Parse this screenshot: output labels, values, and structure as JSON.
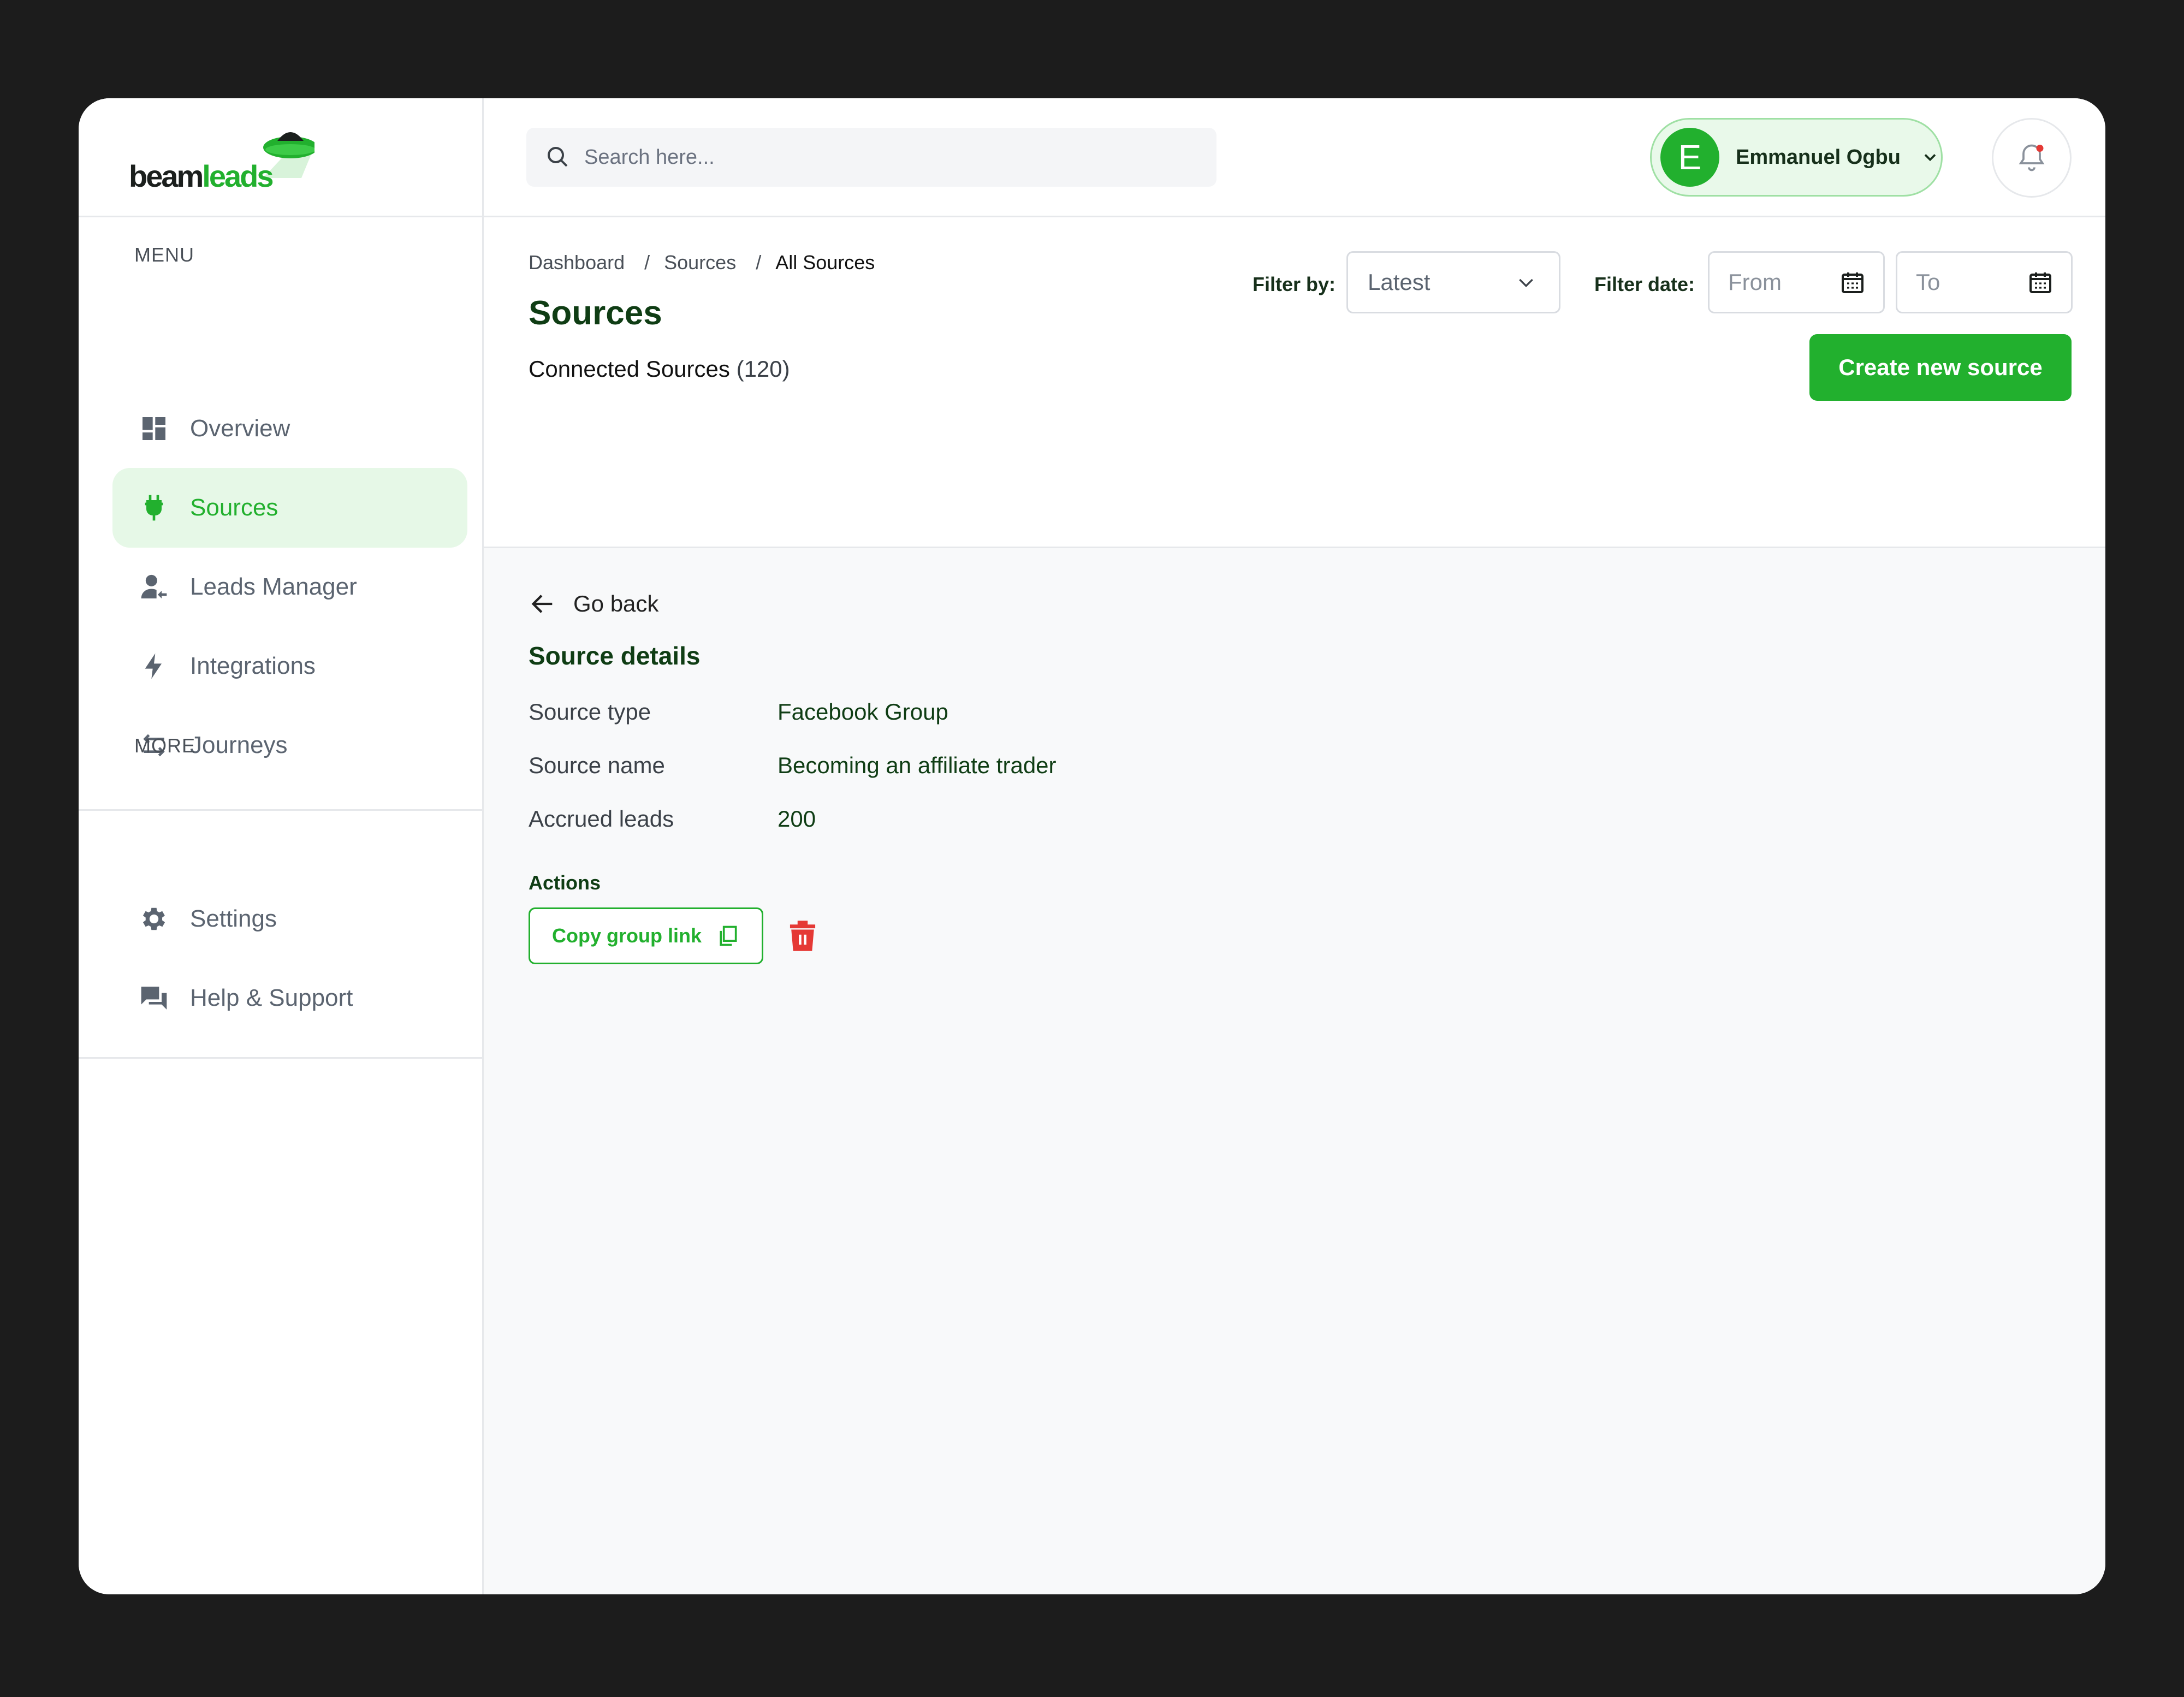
{
  "app": {
    "logo_part1": "beam",
    "logo_part2": "leads"
  },
  "sidebar": {
    "menu_label": "MENU",
    "more_label": "MORE",
    "items": [
      {
        "label": "Overview",
        "icon": "dashboard-icon",
        "active": false
      },
      {
        "label": "Sources",
        "icon": "plug-icon",
        "active": true
      },
      {
        "label": "Leads Manager",
        "icon": "user-icon",
        "active": false
      },
      {
        "label": "Integrations",
        "icon": "lightning-icon",
        "active": false
      },
      {
        "label": "Journeys",
        "icon": "swap-arrows-icon",
        "active": false
      }
    ],
    "more_items": [
      {
        "label": "Settings",
        "icon": "gear-icon"
      },
      {
        "label": "Help & Support",
        "icon": "chat-icon"
      }
    ]
  },
  "header": {
    "search_placeholder": "Search here...",
    "user": {
      "initial": "E",
      "name": "Emmanuel Ogbu"
    }
  },
  "page": {
    "breadcrumb": [
      "Dashboard",
      "Sources",
      "All Sources"
    ],
    "breadcrumb_sep": "/",
    "title": "Sources",
    "connected_label": "Connected Sources",
    "connected_count": "(120)",
    "filter_by_label": "Filter by:",
    "filter_by_value": "Latest",
    "filter_date_label": "Filter date:",
    "date_from_placeholder": "From",
    "date_to_placeholder": "To",
    "create_button": "Create new source"
  },
  "details": {
    "go_back": "Go back",
    "title": "Source details",
    "rows": [
      {
        "key": "Source type",
        "value": "Facebook Group"
      },
      {
        "key": "Source name",
        "value": "Becoming an affiliate trader"
      },
      {
        "key": "Accrued leads",
        "value": "200"
      }
    ],
    "actions_label": "Actions",
    "copy_button": "Copy group link"
  },
  "colors": {
    "brand_green": "#22b02e",
    "dark_green": "#0f3d14",
    "active_bg": "#e6f8e7",
    "danger_red": "#e53935"
  }
}
